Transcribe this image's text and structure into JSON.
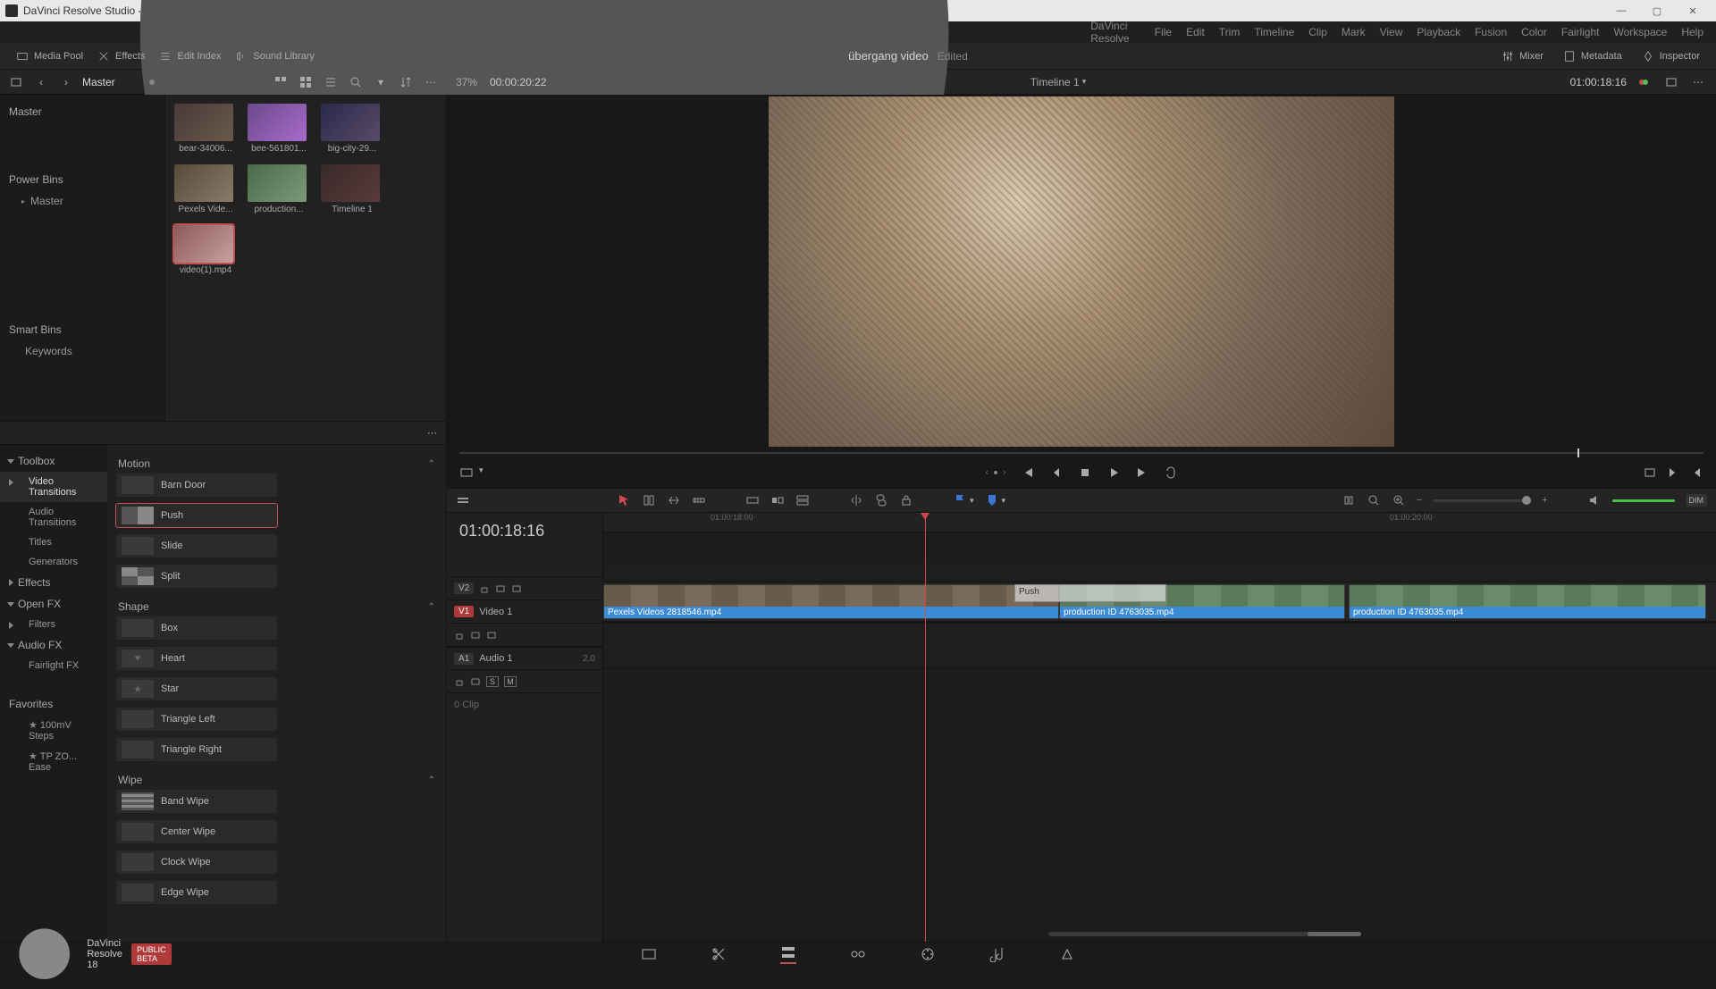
{
  "window": {
    "title": "DaVinci Resolve Studio - übergang video"
  },
  "menu": [
    "DaVinci Resolve",
    "File",
    "Edit",
    "Trim",
    "Timeline",
    "Clip",
    "Mark",
    "View",
    "Playback",
    "Fusion",
    "Color",
    "Fairlight",
    "Workspace",
    "Help"
  ],
  "toolbar": {
    "media_pool": "Media Pool",
    "effects": "Effects",
    "edit_index": "Edit Index",
    "sound_library": "Sound Library",
    "project_title": "übergang video",
    "edited": "Edited",
    "mixer": "Mixer",
    "metadata": "Metadata",
    "inspector": "Inspector"
  },
  "subbar": {
    "bin_path": "Master",
    "zoom_percent": "37%",
    "src_tc": "00:00:20:22",
    "timeline_name": "Timeline 1",
    "rec_tc": "01:00:18:16"
  },
  "bins": {
    "master": "Master",
    "power_bins": "Power Bins",
    "power_master": "Master",
    "smart_bins": "Smart Bins",
    "keywords": "Keywords"
  },
  "clips": [
    {
      "label": "bear-34006..."
    },
    {
      "label": "bee-561801..."
    },
    {
      "label": "big-city-29..."
    },
    {
      "label": "Pexels Vide..."
    },
    {
      "label": "production..."
    },
    {
      "label": "Timeline 1"
    },
    {
      "label": "video(1).mp4",
      "selected": true
    }
  ],
  "fx_categories": {
    "toolbox": "Toolbox",
    "video_transitions": "Video Transitions",
    "audio_transitions": "Audio Transitions",
    "titles": "Titles",
    "generators": "Generators",
    "effects": "Effects",
    "open_fx": "Open FX",
    "filters": "Filters",
    "audio_fx": "Audio FX",
    "fairlight_fx": "Fairlight FX",
    "favorites": "Favorites",
    "fav_100mv": "100mV Steps",
    "fav_tpzo": "TP ZO... Ease"
  },
  "fx_groups": [
    {
      "name": "Motion",
      "items": [
        "Barn Door",
        "Push",
        "Slide",
        "Split"
      ],
      "selected_index": 1
    },
    {
      "name": "Shape",
      "items": [
        "Box",
        "Heart",
        "Star",
        "Triangle Left",
        "Triangle Right"
      ]
    },
    {
      "name": "Wipe",
      "items": [
        "Band Wipe",
        "Center Wipe",
        "Clock Wipe",
        "Edge Wipe"
      ]
    }
  ],
  "timeline": {
    "tc": "01:00:18:16",
    "tracks": {
      "v2": "V2",
      "v1": "V1",
      "video1": "Video 1",
      "a1": "A1",
      "audio1": "Audio 1",
      "a1_meter": "2.0",
      "zero_clip": "0 Clip",
      "s": "S",
      "m": "M"
    },
    "ruler": [
      "01:00:18:00",
      "01:00:20:00"
    ],
    "clips": [
      {
        "name": "Pexels Videos 2818546.mp4"
      },
      {
        "name": "production ID 4763035.mp4"
      },
      {
        "name": "production ID 4763035.mp4"
      }
    ],
    "transition_label": "Push"
  },
  "footer": {
    "version": "DaVinci Resolve 18",
    "beta": "PUBLIC BETA"
  }
}
